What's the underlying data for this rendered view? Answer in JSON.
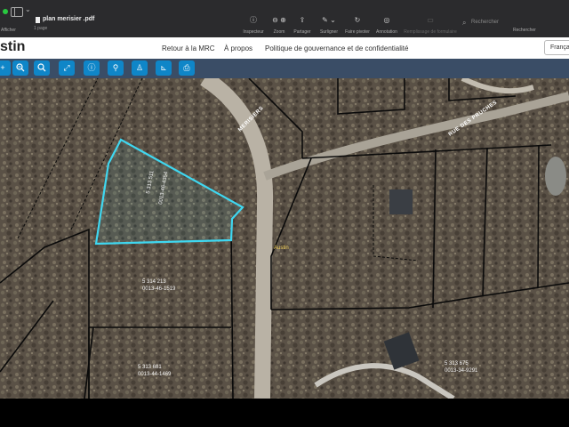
{
  "viewer": {
    "sidebar_label": "Afficher",
    "doc_title": "plan merisier .pdf",
    "doc_pages": "1 page",
    "tools": [
      {
        "label": "Inspecteur",
        "icon": "info-icon",
        "glyph": "ⓘ",
        "enabled": true
      },
      {
        "label": "Zoom",
        "icon": "zoom-icon",
        "glyph": "⊖ ⊕",
        "enabled": true
      },
      {
        "label": "Partager",
        "icon": "share-icon",
        "glyph": "⇪",
        "enabled": true
      },
      {
        "label": "Surligner",
        "icon": "highlight-icon",
        "glyph": "✎ ⌄",
        "enabled": true
      },
      {
        "label": "Faire pivoter",
        "icon": "rotate-icon",
        "glyph": "↻",
        "enabled": true
      },
      {
        "label": "Annotation",
        "icon": "annotation-icon",
        "glyph": "◎",
        "enabled": true
      },
      {
        "label": "Remplissage de formulaire",
        "icon": "form-fill-icon",
        "glyph": "▭",
        "enabled": false
      }
    ],
    "search_placeholder": "Rechercher",
    "search_label": "Rechercher"
  },
  "site": {
    "brand": "stin",
    "nav": [
      {
        "label": "Retour à la MRC"
      },
      {
        "label": "À propos"
      },
      {
        "label": "Politique de gouvernance et de confidentialité"
      }
    ],
    "language": "Françai"
  },
  "map_tools": [
    {
      "name": "zoom-in-icon",
      "glyph": "+"
    },
    {
      "name": "zoom-out-icon",
      "glyph": "−"
    },
    {
      "name": "zoom-icon",
      "glyph": "⌕"
    },
    {
      "name": "full-extent-icon",
      "glyph": "⤢"
    },
    {
      "name": "identify-icon",
      "glyph": "ⓘ"
    },
    {
      "name": "location-pin-icon",
      "glyph": "⚲"
    },
    {
      "name": "street-view-icon",
      "glyph": "♙"
    },
    {
      "name": "measure-icon",
      "glyph": "⊾"
    },
    {
      "name": "print-icon",
      "glyph": "⎙"
    }
  ],
  "map": {
    "street_merisiers": "MERISIERS",
    "street_pruches": "RUE DES PRUCHES",
    "place_label": "Austin",
    "highlight_color": "#3fd7f0",
    "lot_labels": [
      {
        "id": "selected",
        "text": "5 313 511"
      },
      {
        "id": "lot-a",
        "text": "0013-46-4354"
      },
      {
        "id": "lot-b",
        "text": "5 314 213"
      },
      {
        "id": "lot-c",
        "text": "0013-46-1519"
      },
      {
        "id": "lot-d",
        "text": "5 313 681"
      },
      {
        "id": "lot-e",
        "text": "0013-44-1469"
      },
      {
        "id": "lot-f",
        "text": "5 313 675"
      },
      {
        "id": "lot-g",
        "text": "0013-34-9291"
      }
    ]
  }
}
